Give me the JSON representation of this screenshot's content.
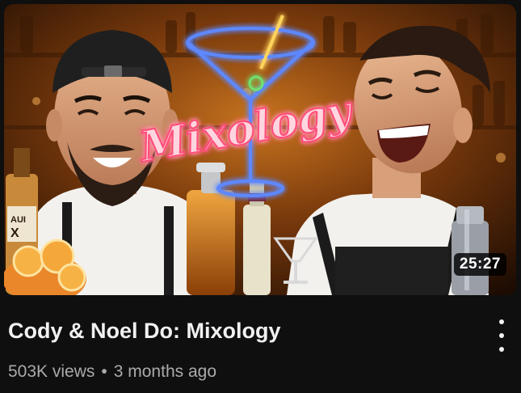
{
  "video": {
    "title": "Cody & Noel Do: Mixology",
    "views": "503K views",
    "separator": "•",
    "age": "3 months ago",
    "duration": "25:27"
  },
  "thumbnail": {
    "neon_text": "Mixology",
    "bottle_label_left": "AUI",
    "bottle_label_left_2": "X"
  },
  "icons": {
    "more": "more-vert-icon"
  },
  "colors": {
    "background": "#0f0f0f",
    "title": "#f1f1f1",
    "meta": "#aaaaaa",
    "neon_pink": "#ff4f7a",
    "neon_blue": "#4a7bff"
  }
}
